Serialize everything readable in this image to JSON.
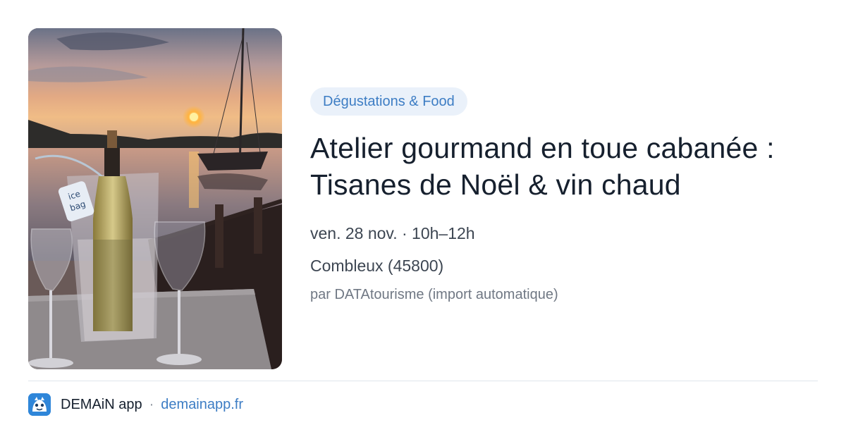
{
  "photo": {
    "label_text": "ice bag"
  },
  "event": {
    "category": "Dégustations & Food",
    "title_line1": "Atelier gourmand en toue cabanée :",
    "title_line2": "Tisanes de Noël & vin chaud",
    "datetime": "ven. 28 nov. · 10h–12h",
    "location": "Combleux (45800)",
    "source": "par DATAtourisme (import automatique)"
  },
  "footer": {
    "app_name": "DEMAiN app",
    "separator": "·",
    "url": "demainapp.fr"
  },
  "colors": {
    "accent": "#3d7dc4",
    "tag_bg": "#eaf1fa",
    "title": "#16202e",
    "logo": "#2f86d9"
  }
}
